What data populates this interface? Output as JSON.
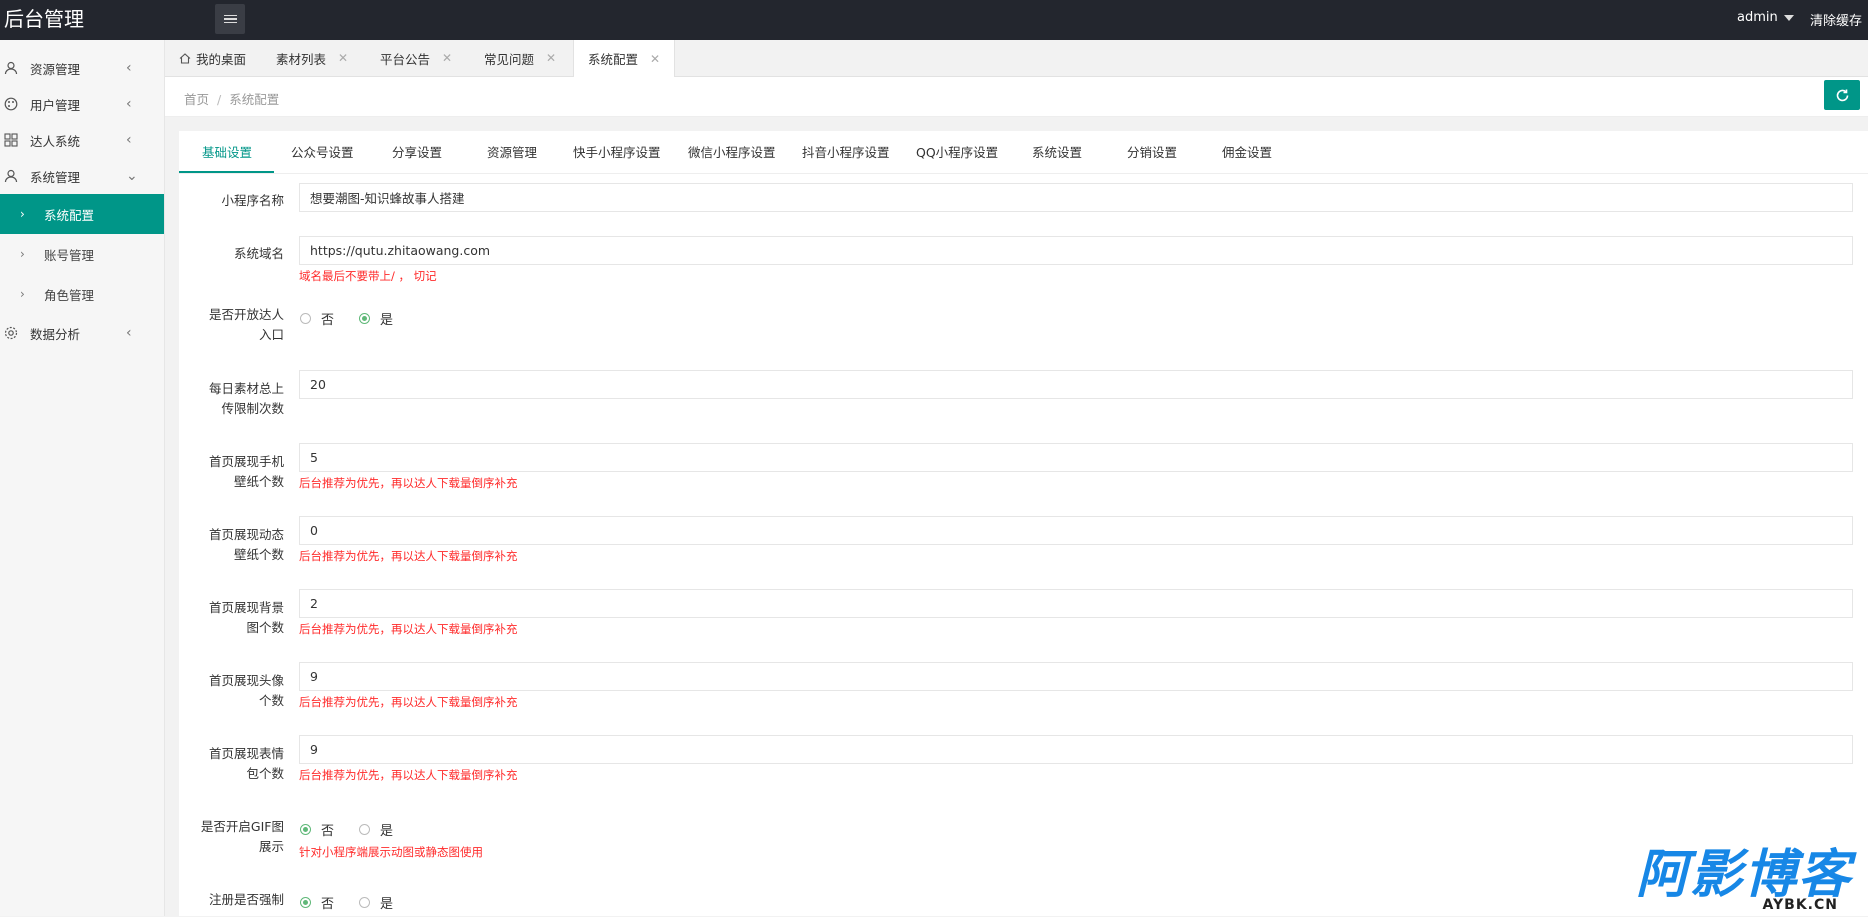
{
  "header": {
    "app_title": "后台管理",
    "admin_label": "admin",
    "clear_cache_label": "清除缓存"
  },
  "sidebar": {
    "items": [
      {
        "label": "资源管理",
        "arrow": "‹"
      },
      {
        "label": "用户管理",
        "arrow": "‹"
      },
      {
        "label": "达人系统",
        "arrow": "‹"
      },
      {
        "label": "系统管理",
        "arrow": "⌄"
      },
      {
        "label": "数据分析",
        "arrow": "‹"
      }
    ],
    "sub_items": [
      {
        "label": "系统配置",
        "active": true
      },
      {
        "label": "账号管理",
        "active": false
      },
      {
        "label": "角色管理",
        "active": false
      }
    ],
    "chevron": "›"
  },
  "tabs": [
    {
      "label": "我的桌面"
    },
    {
      "label": "素材列表",
      "close": "✕"
    },
    {
      "label": "平台公告",
      "close": "✕"
    },
    {
      "label": "常见问题",
      "close": "✕"
    },
    {
      "label": "系统配置",
      "close": "✕",
      "active": true
    }
  ],
  "breadcrumb": {
    "home": "首页",
    "sep": "/",
    "current": "系统配置"
  },
  "config_tabs": [
    "基础设置",
    "公众号设置",
    "分享设置",
    "资源管理",
    "快手小程序设置",
    "微信小程序设置",
    "抖音小程序设置",
    "QQ小程序设置",
    "系统设置",
    "分销设置",
    "佣金设置"
  ],
  "form": {
    "app_name": {
      "label": "小程序名称",
      "value": "想要潮图-知识蜂故事人搭建"
    },
    "domain": {
      "label": "系统域名",
      "value": "https://qutu.zhitaowang.com",
      "hint": "域名最后不要带上/ ， 切记"
    },
    "open_entry": {
      "label_1": "是否开放达人",
      "label_2": "入口",
      "opt_no": "否",
      "opt_yes": "是",
      "selected": "是"
    },
    "daily_limit": {
      "label_1": "每日素材总上",
      "label_2": "传限制次数",
      "value": "20"
    },
    "phone_wallpaper": {
      "label_1": "首页展现手机",
      "label_2": "壁纸个数",
      "value": "5",
      "hint": "后台推荐为优先，再以达人下载量倒序补充"
    },
    "dynamic_wallpaper": {
      "label_1": "首页展现动态",
      "label_2": "壁纸个数",
      "value": "0",
      "hint": "后台推荐为优先，再以达人下载量倒序补充"
    },
    "background": {
      "label_1": "首页展现背景",
      "label_2": "图个数",
      "value": "2",
      "hint": "后台推荐为优先，再以达人下载量倒序补充"
    },
    "avatar": {
      "label_1": "首页展现头像",
      "label_2": "个数",
      "value": "9",
      "hint": "后台推荐为优先，再以达人下载量倒序补充"
    },
    "emoji": {
      "label_1": "首页展现表情",
      "label_2": "包个数",
      "value": "9",
      "hint": "后台推荐为优先，再以达人下载量倒序补充"
    },
    "gif": {
      "label_1": "是否开启GIF图",
      "label_2": "展示",
      "opt_no": "否",
      "opt_yes": "是",
      "selected": "否",
      "hint": "针对小程序端展示动图或静态图使用"
    },
    "force_register": {
      "label_1": "注册是否强制",
      "opt_no": "否",
      "opt_yes": "是",
      "selected": "否"
    }
  },
  "watermark": {
    "main": "阿影博客",
    "sub": "AYBK.CN"
  },
  "colors": {
    "accent": "#009688",
    "header_bg": "#23262e",
    "hint_red": "#ff2b2b",
    "radio_green": "#5fb878"
  }
}
